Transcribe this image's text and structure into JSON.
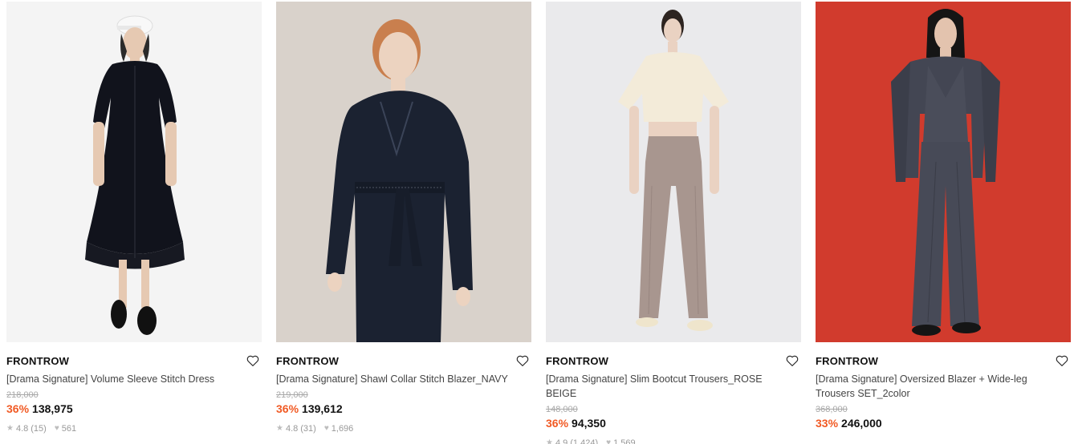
{
  "products": [
    {
      "brand": "FRONTROW",
      "title": "[Drama Signature] Volume Sleeve Stitch Dress",
      "original_price": "218,000",
      "discount": "36%",
      "price": "138,975",
      "rating": "4.8",
      "reviews": "(15)",
      "likes": "561",
      "image_bg": "#f2f2f2"
    },
    {
      "brand": "FRONTROW",
      "title": "[Drama Signature] Shawl Collar Stitch Blazer_NAVY",
      "original_price": "219,000",
      "discount": "36%",
      "price": "139,612",
      "rating": "4.8",
      "reviews": "(31)",
      "likes": "1,696",
      "image_bg": "#d8d1ca"
    },
    {
      "brand": "FRONTROW",
      "title": "[Drama Signature] Slim Bootcut Trousers_ROSE BEIGE",
      "original_price": "148,000",
      "discount": "36%",
      "price": "94,350",
      "rating": "4.9",
      "reviews": "(1,424)",
      "likes": "1,569",
      "image_bg": "#e9e9eb"
    },
    {
      "brand": "FRONTROW",
      "title": "[Drama Signature] Oversized Blazer + Wide-leg Trousers SET_2color",
      "original_price": "368,000",
      "discount": "33%",
      "price": "246,000",
      "image_bg": "#d33a2c"
    }
  ],
  "icons": {
    "wishlist": "heart-outline-icon",
    "rating": "star-icon",
    "likes": "heart-icon"
  },
  "colors": {
    "discount": "#f15a24",
    "strike": "#a8a8a8",
    "meta": "#999999"
  }
}
